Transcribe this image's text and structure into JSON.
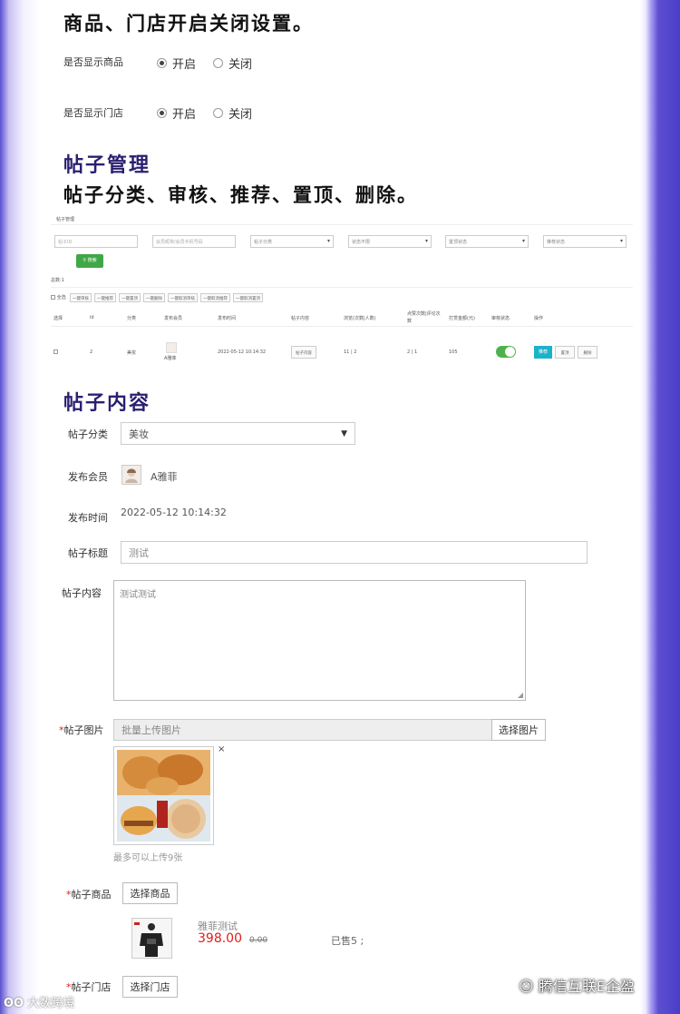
{
  "section_store": {
    "title": "商品、门店开启关闭设置。",
    "rows": [
      {
        "label": "是否显示商品",
        "on": "开启",
        "off": "关闭"
      },
      {
        "label": "是否显示门店",
        "on": "开启",
        "off": "关闭"
      }
    ]
  },
  "section_manage": {
    "title": "帖子管理",
    "subtitle": "帖子分类、审核、推荐、置顶、删除。",
    "panel": {
      "header": "帖子管理",
      "filters": {
        "id_placeholder": "帖子ID",
        "member_placeholder": "会员昵称/会员手机号码",
        "category": "帖子分类",
        "status": "状态不限",
        "top_status": "置顶状态",
        "recommend_status": "推荐状态"
      },
      "search_label": "搜索",
      "total": "总数:1",
      "select_all": "全选",
      "bulk_actions": [
        "一键审核",
        "一键推荐",
        "一键置顶",
        "一键删除",
        "一键取消审核",
        "一键取消推荐",
        "一键取消置顶"
      ],
      "columns": [
        "选择",
        "id",
        "分类",
        "发布会员",
        "发布时间",
        "帖子内容",
        "浏览(次数|人数)",
        "点赞次数|评论次数",
        "打赏金额(元)",
        "审核状态",
        "操作"
      ],
      "row": {
        "id": "2",
        "category": "美妆",
        "member": "A雅菲",
        "time": "2022-05-12 10:14:32",
        "content_btn": "帖子内容",
        "views": "11 | 2",
        "likes": "2 | 1",
        "reward": "105",
        "actions": [
          "推荐",
          "置顶",
          "删除"
        ]
      }
    }
  },
  "section_content": {
    "title": "帖子内容",
    "category_label": "帖子分类",
    "category_value": "美妆",
    "member_label": "发布会员",
    "member_value": "A雅菲",
    "time_label": "发布时间",
    "time_value": "2022-05-12 10:14:32",
    "post_title_label": "帖子标题",
    "post_title_value": "测试",
    "content_label": "帖子内容",
    "content_value": "测试测试",
    "images_label": "帖子图片",
    "images_placeholder": "批量上传图片",
    "choose_image": "选择图片",
    "remove": "×",
    "images_hint": "最多可以上传9张",
    "goods_label": "帖子商品",
    "choose_goods": "选择商品",
    "goods": {
      "name": "雅菲测试",
      "price": "398.00",
      "orig_price": "0.00",
      "sold": "已售5 ;"
    },
    "store_label": "帖子门店",
    "choose_store": "选择门店",
    "required_mark": "*"
  },
  "watermarks": {
    "left": "大数跨境",
    "right": "腾信互联E企盈"
  },
  "colors": {
    "accent_purple": "#2a2070",
    "green": "#3fa846",
    "red": "#e21b1b",
    "cyan": "#1bb3c9"
  }
}
